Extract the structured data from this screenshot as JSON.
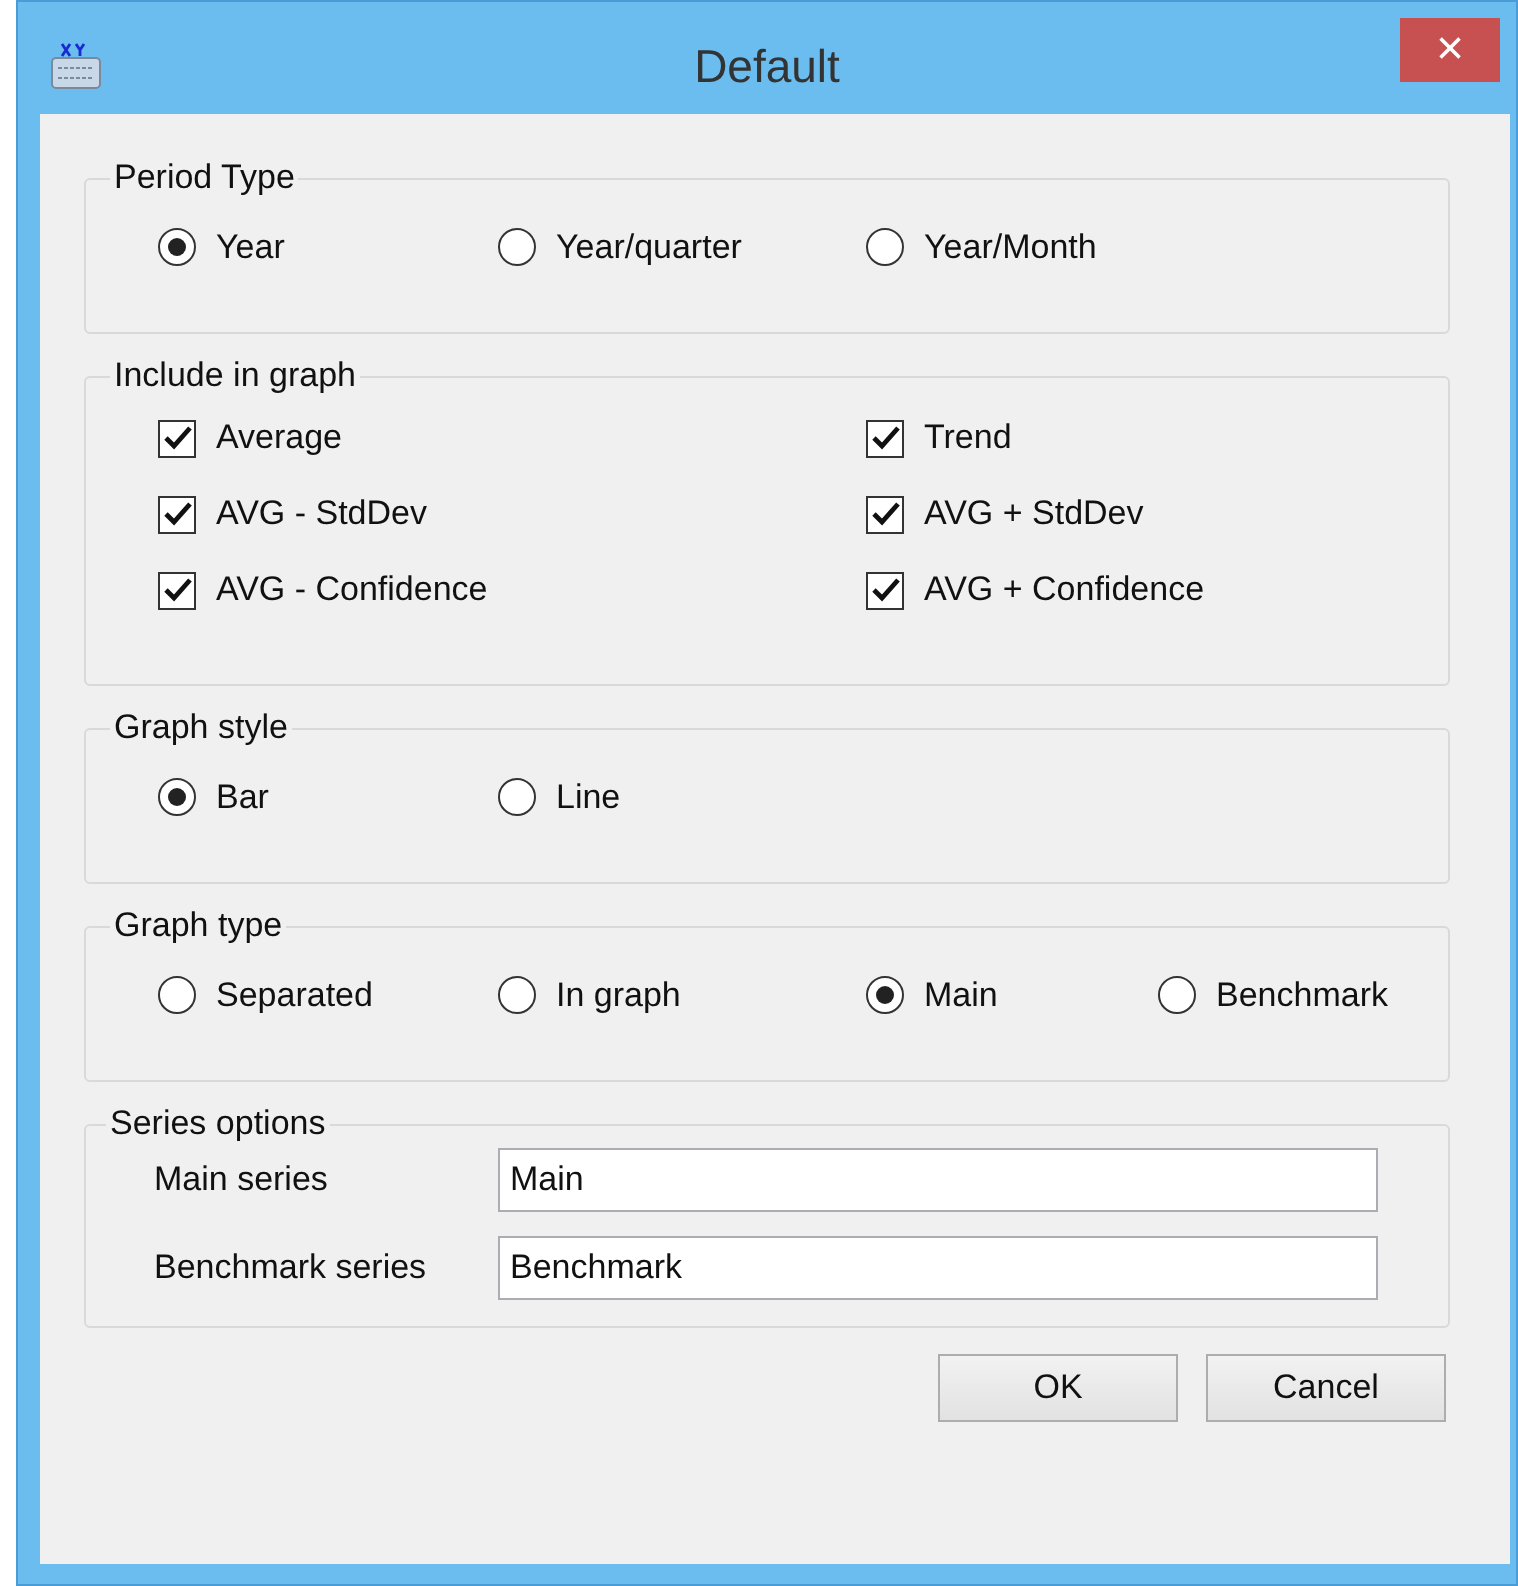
{
  "window": {
    "title": "Default",
    "close": "×"
  },
  "period_type": {
    "label": "Period Type",
    "options": [
      {
        "label": "Year",
        "selected": true
      },
      {
        "label": "Year/quarter",
        "selected": false
      },
      {
        "label": "Year/Month",
        "selected": false
      }
    ]
  },
  "include_in_graph": {
    "label": "Include in graph",
    "items": [
      {
        "label": "Average",
        "checked": true
      },
      {
        "label": "Trend",
        "checked": true
      },
      {
        "label": "AVG - StdDev",
        "checked": true
      },
      {
        "label": "AVG + StdDev",
        "checked": true
      },
      {
        "label": "AVG - Confidence",
        "checked": true
      },
      {
        "label": "AVG + Confidence",
        "checked": true
      }
    ]
  },
  "graph_style": {
    "label": "Graph style",
    "options": [
      {
        "label": "Bar",
        "selected": true
      },
      {
        "label": "Line",
        "selected": false
      }
    ]
  },
  "graph_type": {
    "label": "Graph type",
    "options": [
      {
        "label": "Separated",
        "selected": false
      },
      {
        "label": "In graph",
        "selected": false
      },
      {
        "label": "Main",
        "selected": true
      },
      {
        "label": "Benchmark",
        "selected": false
      }
    ]
  },
  "series_options": {
    "label": "Series options",
    "fields": [
      {
        "label": "Main series",
        "value": "Main"
      },
      {
        "label": "Benchmark series",
        "value": "Benchmark"
      }
    ]
  },
  "buttons": [
    "OK",
    "Cancel"
  ]
}
